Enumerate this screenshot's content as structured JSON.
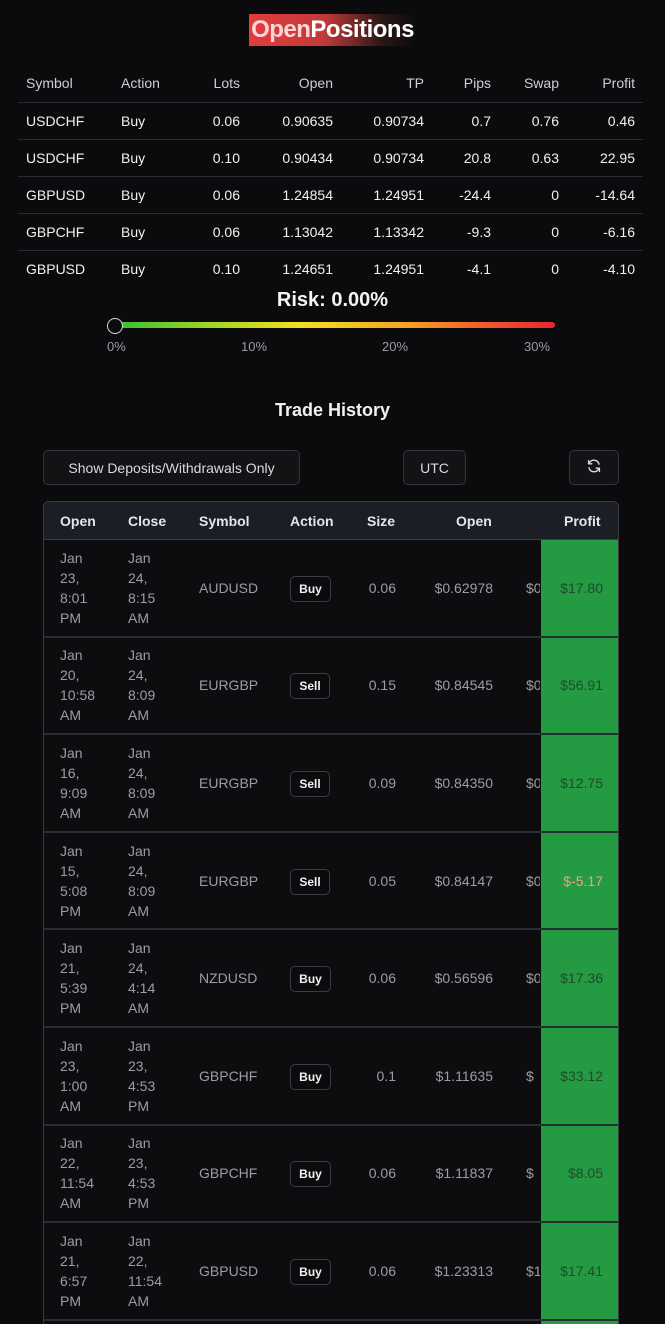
{
  "open_positions": {
    "title_a": "Open",
    "title_b": "Positions",
    "columns": [
      "Symbol",
      "Action",
      "Lots",
      "Open",
      "TP",
      "Pips",
      "Swap",
      "Profit"
    ],
    "rows": [
      [
        "USDCHF",
        "Buy",
        "0.06",
        "0.90635",
        "0.90734",
        "0.7",
        "0.76",
        "0.46"
      ],
      [
        "USDCHF",
        "Buy",
        "0.10",
        "0.90434",
        "0.90734",
        "20.8",
        "0.63",
        "22.95"
      ],
      [
        "GBPUSD",
        "Buy",
        "0.06",
        "1.24854",
        "1.24951",
        "-24.4",
        "0",
        "-14.64"
      ],
      [
        "GBPCHF",
        "Buy",
        "0.06",
        "1.13042",
        "1.13342",
        "-9.3",
        "0",
        "-6.16"
      ],
      [
        "GBPUSD",
        "Buy",
        "0.10",
        "1.24651",
        "1.24951",
        "-4.1",
        "0",
        "-4.10"
      ]
    ]
  },
  "risk": {
    "label": "Risk: 0.00%",
    "value_percent": 0,
    "ticks": [
      "0%",
      "10%",
      "20%",
      "30%"
    ],
    "gradient": [
      "#2fbf3a",
      "#f3e11e",
      "#e8242f"
    ]
  },
  "trade_history": {
    "title": "Trade History",
    "deposits_button": "Show Deposits/Withdrawals Only",
    "timezone_button": "UTC",
    "refresh_icon": "refresh-icon",
    "columns": [
      "Open",
      "Close",
      "Symbol",
      "Action",
      "Size",
      "Open",
      "Profit"
    ],
    "rows": [
      {
        "open": [
          "Jan",
          "23,",
          "8:01",
          "PM"
        ],
        "close": [
          "Jan",
          "24,",
          "8:15",
          "AM"
        ],
        "symbol": "AUDUSD",
        "action": "Buy",
        "size": "0.06",
        "open_price": "$0.62978",
        "clipped": "$0",
        "profit": "$17.80"
      },
      {
        "open": [
          "Jan",
          "20,",
          "10:58",
          "AM"
        ],
        "close": [
          "Jan",
          "24,",
          "8:09",
          "AM"
        ],
        "symbol": "EURGBP",
        "action": "Sell",
        "size": "0.15",
        "open_price": "$0.84545",
        "clipped": "$0",
        "profit": "$56.91"
      },
      {
        "open": [
          "Jan",
          "16,",
          "9:09",
          "AM"
        ],
        "close": [
          "Jan",
          "24,",
          "8:09",
          "AM"
        ],
        "symbol": "EURGBP",
        "action": "Sell",
        "size": "0.09",
        "open_price": "$0.84350",
        "clipped": "$0",
        "profit": "$12.75"
      },
      {
        "open": [
          "Jan",
          "15,",
          "5:08",
          "PM"
        ],
        "close": [
          "Jan",
          "24,",
          "8:09",
          "AM"
        ],
        "symbol": "EURGBP",
        "action": "Sell",
        "size": "0.05",
        "open_price": "$0.84147",
        "clipped": "$0",
        "profit": "$-5.17"
      },
      {
        "open": [
          "Jan",
          "21,",
          "5:39",
          "PM"
        ],
        "close": [
          "Jan",
          "24,",
          "4:14",
          "AM"
        ],
        "symbol": "NZDUSD",
        "action": "Buy",
        "size": "0.06",
        "open_price": "$0.56596",
        "clipped": "$0",
        "profit": "$17.36"
      },
      {
        "open": [
          "Jan",
          "23,",
          "1:00",
          "AM"
        ],
        "close": [
          "Jan",
          "23,",
          "4:53",
          "PM"
        ],
        "symbol": "GBPCHF",
        "action": "Buy",
        "size": "0.1",
        "open_price": "$1.11635",
        "clipped": "$",
        "profit": "$33.12"
      },
      {
        "open": [
          "Jan",
          "22,",
          "11:54",
          "AM"
        ],
        "close": [
          "Jan",
          "23,",
          "4:53",
          "PM"
        ],
        "symbol": "GBPCHF",
        "action": "Buy",
        "size": "0.06",
        "open_price": "$1.11837",
        "clipped": "$",
        "profit": "$8.05"
      },
      {
        "open": [
          "Jan",
          "21,",
          "6:57",
          "PM"
        ],
        "close": [
          "Jan",
          "22,",
          "11:54",
          "AM"
        ],
        "symbol": "GBPUSD",
        "action": "Buy",
        "size": "0.06",
        "open_price": "$1.23313",
        "clipped": "$1",
        "profit": "$17.41"
      }
    ],
    "colors": {
      "profit_bg": "#249a42",
      "profit_text": "#1f4a2b",
      "loss_text": "#f2a07a"
    }
  }
}
